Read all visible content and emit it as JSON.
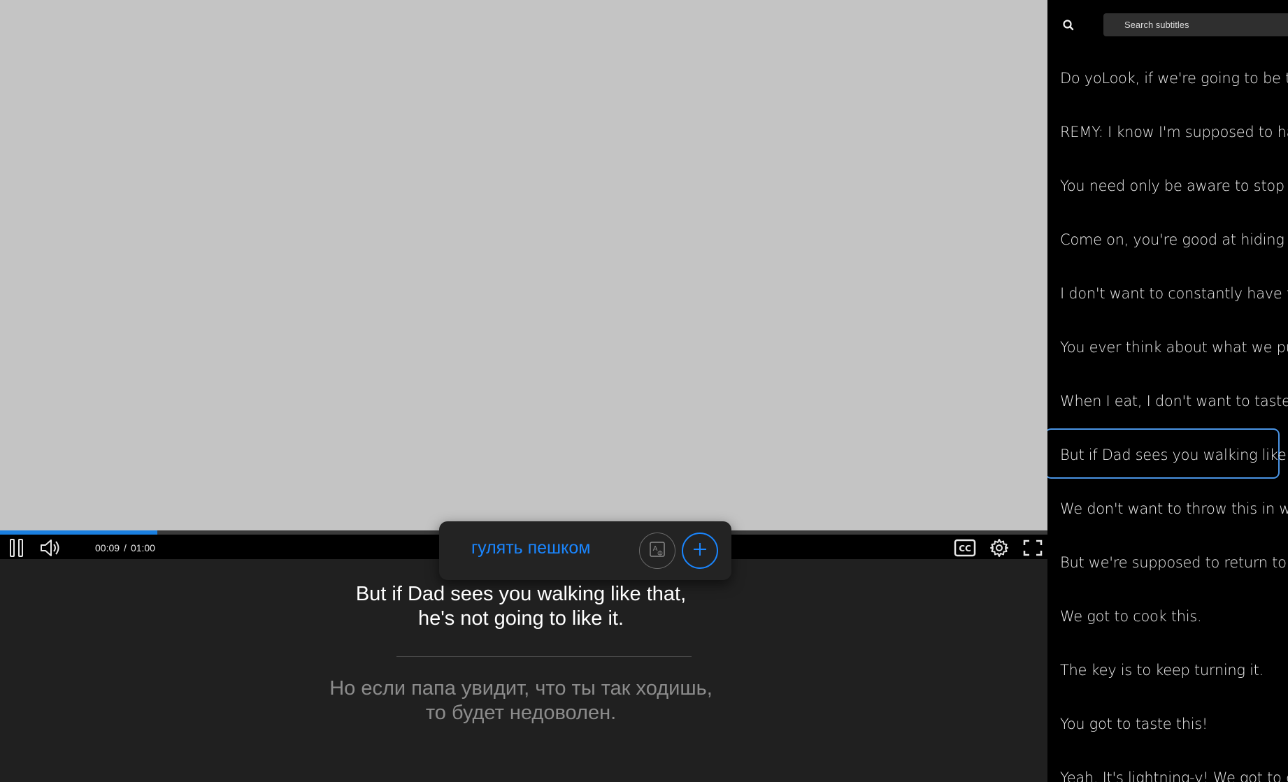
{
  "player": {
    "current_time": "00:09",
    "duration": "01:00",
    "separator": "/",
    "progress_fraction": 0.15
  },
  "word_popup": {
    "word": "гулять пешком"
  },
  "subtitle": {
    "original_line1": "But if Dad sees you walking like that,",
    "original_line2": "he's not going to like it.",
    "translation_line1": "Но если папа увидит, что ты так ходишь,",
    "translation_line2": "то будет недоволен."
  },
  "sidebar": {
    "search_placeholder": "Search subtitles",
    "active_index": 7,
    "items": [
      "Do yoLook, if we're going to be thieves",
      "REMY: I know I'm supposed to hate humans",
      "You need only be aware to stop and savor",
      "Come on, you're good at hiding food",
      "I don't want to constantly have to walk",
      "You ever think about what we put into our",
      "When I eat, I don't want to taste everything",
      "But if Dad sees you walking like that",
      "We don't want to throw this in with the",
      "But we're supposed to return to the colony",
      "We got to cook this.",
      "The key is to keep turning it.",
      "You got to taste this!",
      "Yeah. It's lightning-y! We got to do this"
    ]
  },
  "colors": {
    "accent": "#1a86ff",
    "progress": "#1a7fe0",
    "active_frame": "#4a94e4",
    "video_placeholder": "#c4c4c4",
    "background": "#202020"
  },
  "icons": {
    "pause": "pause-icon",
    "volume": "volume-icon",
    "cc": "cc-icon",
    "settings": "gear-icon",
    "fullscreen": "fullscreen-icon",
    "translate": "translate-icon",
    "add": "plus-icon",
    "search": "search-icon"
  }
}
